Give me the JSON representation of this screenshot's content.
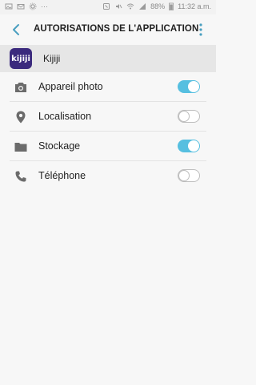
{
  "status": {
    "battery": "88%",
    "time": "11:32 a.m."
  },
  "header": {
    "title": "AUTORISATIONS DE L'APPLICATION"
  },
  "app": {
    "icon_text": "kijiji",
    "name": "Kijiji"
  },
  "permissions": [
    {
      "label": "Appareil photo",
      "icon": "camera-icon",
      "enabled": true
    },
    {
      "label": "Localisation",
      "icon": "location-icon",
      "enabled": false
    },
    {
      "label": "Stockage",
      "icon": "folder-icon",
      "enabled": true
    },
    {
      "label": "Téléphone",
      "icon": "phone-icon",
      "enabled": false
    }
  ],
  "colors": {
    "accent": "#56bfe0",
    "app_icon_bg": "#3b2a7d",
    "back_arrow": "#4a9fc0"
  }
}
